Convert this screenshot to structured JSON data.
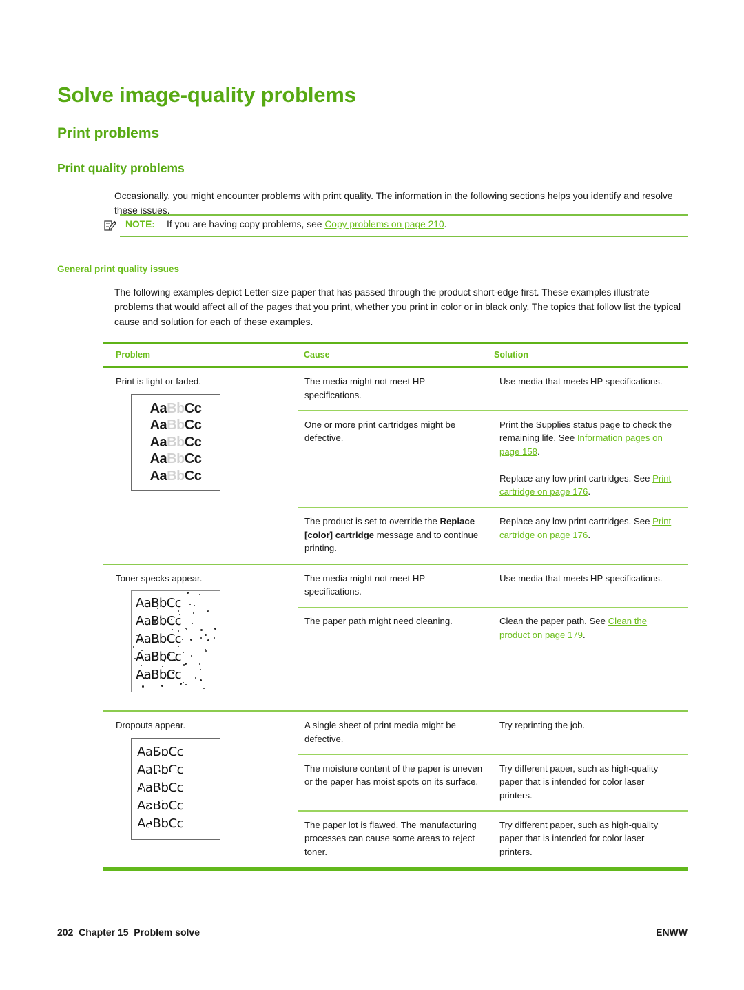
{
  "colors": {
    "green_heading": "#57A913",
    "green_accent": "#6BBD1B",
    "rule_heavy": "#5FB318",
    "rule_light": "#8CCB4F",
    "link": "#6BBD1B",
    "body_text": "#1a1a1a"
  },
  "headings": {
    "h1": "Solve image-quality problems",
    "h2": "Print problems",
    "h3": "Print quality problems",
    "h4": "General print quality issues"
  },
  "paragraphs": {
    "intro": "Occasionally, you might encounter problems with print quality. The information in the following sections helps you identify and resolve these issues.",
    "examples": "The following examples depict Letter-size paper that has passed through the product short-edge first. These examples illustrate problems that would affect all of the pages that you print, whether you print in color or in black only. The topics that follow list the typical cause and solution for each of these examples."
  },
  "note": {
    "icon": "note-pencil-icon",
    "label": "NOTE:",
    "text_before": "If you are having copy problems, see ",
    "link": "Copy problems on page 210",
    "text_after": "."
  },
  "table": {
    "headers": [
      "Problem",
      "Cause",
      "Solution"
    ],
    "sections": [
      {
        "problem": "Print is light or faded.",
        "sample": {
          "type": "faded-sample",
          "lines": [
            {
              "dark_left": "Aa",
              "faded": "Bb",
              "dark_right": "Cc"
            },
            {
              "dark_left": "Aa",
              "faded": "Bb",
              "dark_right": "Cc"
            },
            {
              "dark_left": "Aa",
              "faded": "Bb",
              "dark_right": "Cc"
            },
            {
              "dark_left": "Aa",
              "faded": "Bb",
              "dark_right": "Cc"
            },
            {
              "dark_left": "Aa",
              "faded": "Bb",
              "dark_right": "Cc"
            }
          ]
        },
        "rows": [
          {
            "cause": [
              {
                "t": "The media might not meet HP specifications."
              }
            ],
            "solution": [
              {
                "t": "Use media that meets HP specifications."
              }
            ]
          },
          {
            "cause": [
              {
                "t": "One or more print cartridges might be defective."
              }
            ],
            "solution": [
              {
                "t": "Print the Supplies status page to check the remaining life. See "
              },
              {
                "link": "Information pages on page 158"
              },
              {
                "t": "."
              },
              {
                "br": true
              },
              {
                "t": "Replace any low print cartridges. See "
              },
              {
                "link": "Print cartridge on page 176"
              },
              {
                "t": "."
              }
            ]
          },
          {
            "cause": [
              {
                "t": "The product is set to override the "
              },
              {
                "b": "Replace [color] cartridge"
              },
              {
                "t": " message and to continue printing."
              }
            ],
            "solution": [
              {
                "t": "Replace any low print cartridges. See "
              },
              {
                "link": "Print cartridge on page 176"
              },
              {
                "t": "."
              }
            ]
          }
        ]
      },
      {
        "problem": "Toner specks appear.",
        "sample": {
          "type": "specks-sample",
          "lines": [
            "AaBbCc",
            "AaBbCc",
            "AaBbCc",
            "AaBbCc",
            "AaBbCc"
          ]
        },
        "rows": [
          {
            "cause": [
              {
                "t": "The media might not meet HP specifications."
              }
            ],
            "solution": [
              {
                "t": "Use media that meets HP specifications."
              }
            ]
          },
          {
            "cause": [
              {
                "t": "The paper path might need cleaning."
              }
            ],
            "solution": [
              {
                "t": "Clean the paper path. See "
              },
              {
                "link": "Clean the product on page 179"
              },
              {
                "t": "."
              }
            ]
          }
        ]
      },
      {
        "problem": "Dropouts appear.",
        "sample": {
          "type": "dropouts-sample",
          "lines": [
            "AaBbCc",
            "AaBbCc",
            "AaBbCc",
            "AaBbCc",
            "AaBbCc"
          ]
        },
        "rows": [
          {
            "cause": [
              {
                "t": "A single sheet of print media might be defective."
              }
            ],
            "solution": [
              {
                "t": "Try reprinting the job."
              }
            ]
          },
          {
            "cause": [
              {
                "t": "The moisture content of the paper is uneven or the paper has moist spots on its surface."
              }
            ],
            "solution": [
              {
                "t": "Try different paper, such as high-quality paper that is intended for color laser printers."
              }
            ]
          },
          {
            "cause": [
              {
                "t": "The paper lot is flawed. The manufacturing processes can cause some areas to reject toner."
              }
            ],
            "solution": [
              {
                "t": "Try different paper, such as high-quality paper that is intended for color laser printers."
              }
            ]
          }
        ]
      }
    ]
  },
  "footer": {
    "page_number": "202",
    "chapter": "Chapter 15",
    "chapter_title": "Problem solve",
    "right": "ENWW"
  }
}
